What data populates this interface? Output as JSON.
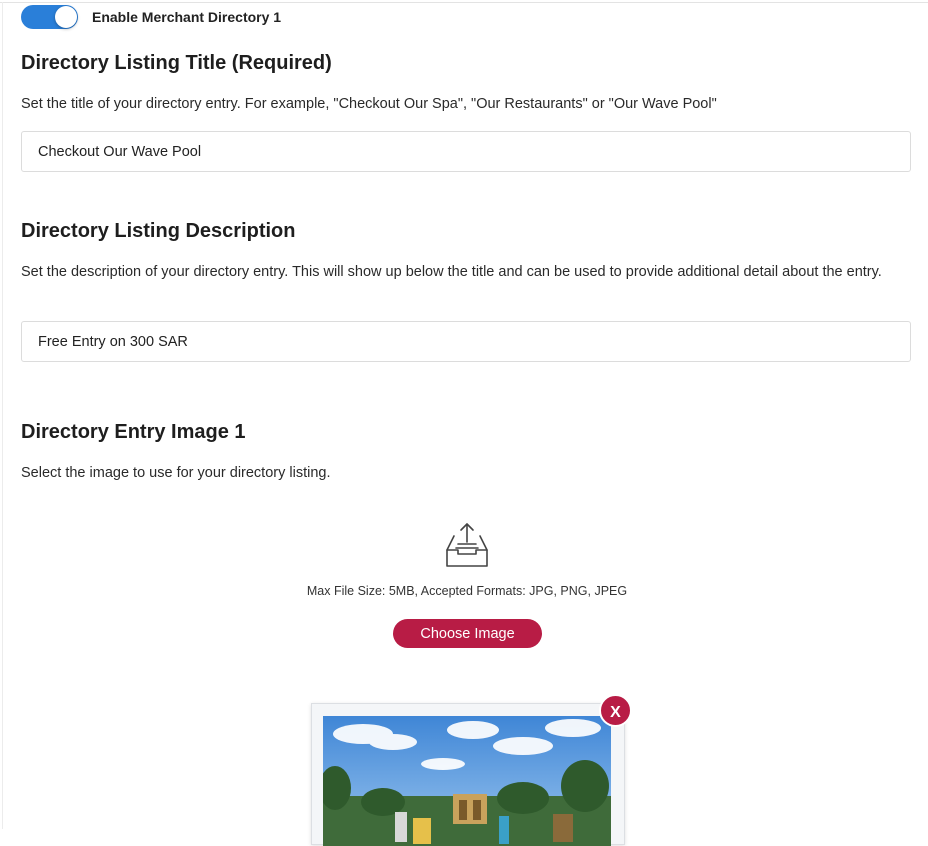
{
  "toggle": {
    "label": "Enable Merchant Directory 1",
    "enabled": true,
    "accent": "#2a7fd9"
  },
  "title_section": {
    "heading": "Directory Listing Title (Required)",
    "description": "Set the title of your directory entry. For example, \"Checkout Our Spa\", \"Our Restaurants\" or \"Our Wave Pool\"",
    "value": "Checkout Our Wave Pool"
  },
  "description_section": {
    "heading": "Directory Listing Description",
    "description": "Set the description of your directory entry. This will show up below the title and can be used to provide additional detail about the entry.",
    "value": "Free Entry on 300 SAR"
  },
  "image_section": {
    "heading": "Directory Entry Image 1",
    "description": "Select the image to use for your directory listing.",
    "upload_icon": "upload-tray-icon",
    "limits": "Max File Size: 5MB, Accepted Formats: JPG, PNG, JPEG",
    "choose_label": "Choose Image",
    "remove_label": "X",
    "accent": "#b81c45"
  }
}
